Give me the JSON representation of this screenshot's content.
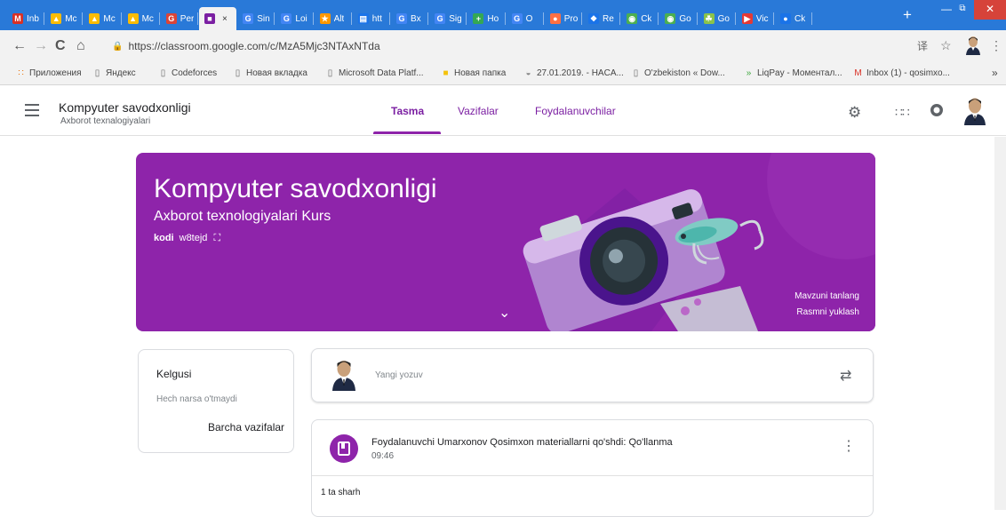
{
  "browser": {
    "tabs": [
      {
        "label": "Inb",
        "color": "#d93025",
        "glyph": "M"
      },
      {
        "label": "Mc",
        "color": "#fbbc04",
        "glyph": "▲"
      },
      {
        "label": "Mc",
        "color": "#fbbc04",
        "glyph": "▲"
      },
      {
        "label": "Mc",
        "color": "#fbbc04",
        "glyph": "▲"
      },
      {
        "label": "Per",
        "color": "#db4437",
        "glyph": "G"
      },
      {
        "label": "",
        "color": "#7b1fa2",
        "glyph": "■"
      },
      {
        "label": "Sin",
        "color": "#4285f4",
        "glyph": "G"
      },
      {
        "label": "Loi",
        "color": "#4285f4",
        "glyph": "G"
      },
      {
        "label": "Alt",
        "color": "#ff9800",
        "glyph": "★"
      },
      {
        "label": "htt",
        "color": "#1a73e8",
        "glyph": "▤"
      },
      {
        "label": "Bx",
        "color": "#4285f4",
        "glyph": "G"
      },
      {
        "label": "Sig",
        "color": "#4285f4",
        "glyph": "G"
      },
      {
        "label": "Ho",
        "color": "#34a853",
        "glyph": "+"
      },
      {
        "label": "O",
        "color": "#4285f4",
        "glyph": "G"
      },
      {
        "label": "Pro",
        "color": "#ff7043",
        "glyph": "●"
      },
      {
        "label": "Re",
        "color": "#1a73e8",
        "glyph": "❖"
      },
      {
        "label": "Ck",
        "color": "#4caf50",
        "glyph": "◉"
      },
      {
        "label": "Go",
        "color": "#4caf50",
        "glyph": "◉"
      },
      {
        "label": "Go",
        "color": "#8bc34a",
        "glyph": "☘"
      },
      {
        "label": "Vic",
        "color": "#e53935",
        "glyph": "▶"
      },
      {
        "label": "Ck",
        "color": "#1a73e8",
        "glyph": "●"
      }
    ],
    "new_tab": "+",
    "active_close": "×",
    "nav": {
      "back": "←",
      "forward": "→",
      "reload": "C",
      "home": "⌂"
    },
    "url": "https://classroom.google.com/c/MzA5Mjc3NTAxNTda",
    "lock": "🔒",
    "translate_icon": "译",
    "star_icon": "☆",
    "menu_icon": "⋮",
    "bookmarks": [
      {
        "label": "Приложения",
        "icon": "apps-icon",
        "glyph": "∷",
        "color": "#e8710a"
      },
      {
        "label": "Яндекс",
        "icon": "page-icon",
        "glyph": "▯",
        "color": "#666"
      },
      {
        "label": "Codeforces",
        "icon": "page-icon",
        "glyph": "▯",
        "color": "#666"
      },
      {
        "label": "Новая вкладка",
        "icon": "page-icon",
        "glyph": "▯",
        "color": "#666"
      },
      {
        "label": "Microsoft Data Platf...",
        "icon": "page-icon",
        "glyph": "▯",
        "color": "#666"
      },
      {
        "label": "Новая папка",
        "icon": "folder-icon",
        "glyph": "■",
        "color": "#f4c20d"
      },
      {
        "label": "27.01.2019. - HACA...",
        "icon": "site-icon",
        "glyph": "◒",
        "color": "#888"
      },
      {
        "label": "O'zbekiston « Dow...",
        "icon": "page-icon",
        "glyph": "▯",
        "color": "#666"
      },
      {
        "label": "LiqPay - Моментал...",
        "icon": "liqpay-icon",
        "glyph": "»",
        "color": "#3aa63a"
      },
      {
        "label": "Inbox (1) - qosimxo...",
        "icon": "gmail-icon",
        "glyph": "M",
        "color": "#d93025"
      }
    ],
    "bookmarks_more": "»"
  },
  "classroom": {
    "title": "Kompyuter savodxonligi",
    "subtitle": "Axborot texnalogiyalari",
    "tabs": [
      "Tasma",
      "Vazifalar",
      "Foydalanuvchilar"
    ],
    "banner": {
      "title": "Kompyuter savodxonligi",
      "subtitle": "Axborot texnologiyalari Kurs",
      "code_label": "kodi",
      "code": "w8tejd",
      "select_theme": "Mavzuni tanlang",
      "upload_photo": "Rasmni yuklash",
      "color": "#8e24aa"
    },
    "upcoming": {
      "title": "Kelgusi",
      "empty": "Hech narsa o'tmaydi",
      "view_all": "Barcha vazifalar"
    },
    "compose": {
      "placeholder": "Yangi yozuv"
    },
    "post": {
      "title": "Foydalanuvchi Umarxonov Qosimxon materiallarni qo'shdi: Qo'llanma",
      "time": "09:46",
      "comments": "1 ta sharh"
    }
  }
}
